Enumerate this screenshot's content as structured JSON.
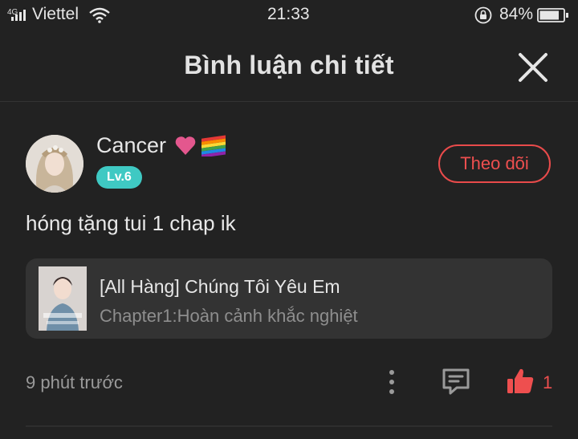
{
  "status_bar": {
    "network": "4G",
    "carrier": "Viettel",
    "time": "21:33",
    "battery": "84%",
    "battery_level": 0.84
  },
  "header": {
    "title": "Bình luận chi tiết"
  },
  "comment": {
    "username": "Cancer",
    "level": "Lv.6",
    "follow_label": "Theo dõi",
    "text": "hóng tặng tui 1 chap ik",
    "time_ago": "9 phút trước",
    "like_count": "1"
  },
  "chapter_card": {
    "title": "[All Hàng] Chúng Tôi Yêu Em",
    "subtitle": "Chapter1:Hoàn cảnh khắc nghiệt"
  },
  "icons": {
    "close": "close-icon",
    "more": "more-vertical-icon",
    "reply": "comment-icon",
    "like": "thumbs-up-icon"
  },
  "colors": {
    "background": "#222222",
    "accent": "#ee4f4f",
    "level_badge": "#3fc9c3",
    "card": "#333333"
  }
}
